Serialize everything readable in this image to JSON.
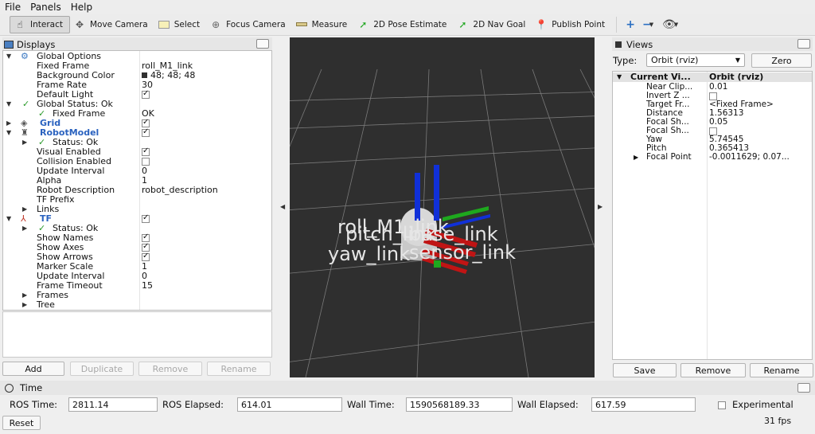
{
  "menu": [
    "File",
    "Panels",
    "Help"
  ],
  "toolbar": {
    "tools": [
      {
        "label": "Interact",
        "icon": "hand-pointer-icon"
      },
      {
        "label": "Move Camera",
        "icon": "move-arrows-icon"
      },
      {
        "label": "Select",
        "icon": "select-box-icon"
      },
      {
        "label": "Focus Camera",
        "icon": "focus-target-icon"
      },
      {
        "label": "Measure",
        "icon": "ruler-icon"
      },
      {
        "label": "2D Pose Estimate",
        "icon": "green-arrow-icon"
      },
      {
        "label": "2D Nav Goal",
        "icon": "green-arrow-icon"
      },
      {
        "label": "Publish Point",
        "icon": "map-pin-icon"
      }
    ],
    "extra_icons": [
      "plus-icon",
      "minus-icon",
      "eye-icon"
    ]
  },
  "displays": {
    "title": "Displays",
    "rows": [
      {
        "label": "Global Options",
        "value": ""
      },
      {
        "label": "Fixed Frame",
        "value": "roll_M1_link"
      },
      {
        "label": "Background Color",
        "value": "48; 48; 48"
      },
      {
        "label": "Frame Rate",
        "value": "30"
      },
      {
        "label": "Default Light",
        "value": ""
      },
      {
        "label": "Global Status: Ok",
        "value": ""
      },
      {
        "label": "Fixed Frame",
        "value": "OK"
      },
      {
        "label": "Grid",
        "value": ""
      },
      {
        "label": "RobotModel",
        "value": ""
      },
      {
        "label": "Status: Ok",
        "value": ""
      },
      {
        "label": "Visual Enabled",
        "value": ""
      },
      {
        "label": "Collision Enabled",
        "value": ""
      },
      {
        "label": "Update Interval",
        "value": "0"
      },
      {
        "label": "Alpha",
        "value": "1"
      },
      {
        "label": "Robot Description",
        "value": "robot_description"
      },
      {
        "label": "TF Prefix",
        "value": ""
      },
      {
        "label": "Links",
        "value": ""
      },
      {
        "label": "TF",
        "value": ""
      },
      {
        "label": "Status: Ok",
        "value": ""
      },
      {
        "label": "Show Names",
        "value": ""
      },
      {
        "label": "Show Axes",
        "value": ""
      },
      {
        "label": "Show Arrows",
        "value": ""
      },
      {
        "label": "Marker Scale",
        "value": "1"
      },
      {
        "label": "Update Interval",
        "value": "0"
      },
      {
        "label": "Frame Timeout",
        "value": "15"
      },
      {
        "label": "Frames",
        "value": ""
      },
      {
        "label": "Tree",
        "value": ""
      }
    ],
    "buttons": {
      "add": "Add",
      "duplicate": "Duplicate",
      "remove": "Remove",
      "rename": "Rename"
    }
  },
  "viewport": {
    "background_color": "#303030",
    "frame_labels": [
      "roll_M1_link",
      "pitch_link",
      "yaw_link",
      "base_link",
      "sensor_link"
    ]
  },
  "views": {
    "title": "Views",
    "type_label": "Type:",
    "type_value": "Orbit (rviz)",
    "zero_label": "Zero",
    "header": {
      "name": "Current Vi...",
      "value": "Orbit (rviz)"
    },
    "rows": [
      {
        "key": "Near Clip...",
        "value": "0.01"
      },
      {
        "key": "Invert Z ...",
        "value": ""
      },
      {
        "key": "Target Fr...",
        "value": "<Fixed Frame>"
      },
      {
        "key": "Distance",
        "value": "1.56313"
      },
      {
        "key": "Focal Sh...",
        "value": "0.05"
      },
      {
        "key": "Focal Sh...",
        "value": ""
      },
      {
        "key": "Yaw",
        "value": "5.74545"
      },
      {
        "key": "Pitch",
        "value": "0.365413"
      },
      {
        "key": "Focal Point",
        "value": "-0.0011629; 0.07..."
      }
    ],
    "buttons": {
      "save": "Save",
      "remove": "Remove",
      "rename": "Rename"
    }
  },
  "time": {
    "title": "Time",
    "ros_time_label": "ROS Time:",
    "ros_time": "2811.14",
    "ros_elapsed_label": "ROS Elapsed:",
    "ros_elapsed": "614.01",
    "wall_time_label": "Wall Time:",
    "wall_time": "1590568189.33",
    "wall_elapsed_label": "Wall Elapsed:",
    "wall_elapsed": "617.59",
    "experimental_label": "Experimental",
    "reset_label": "Reset",
    "fps": "31 fps"
  }
}
